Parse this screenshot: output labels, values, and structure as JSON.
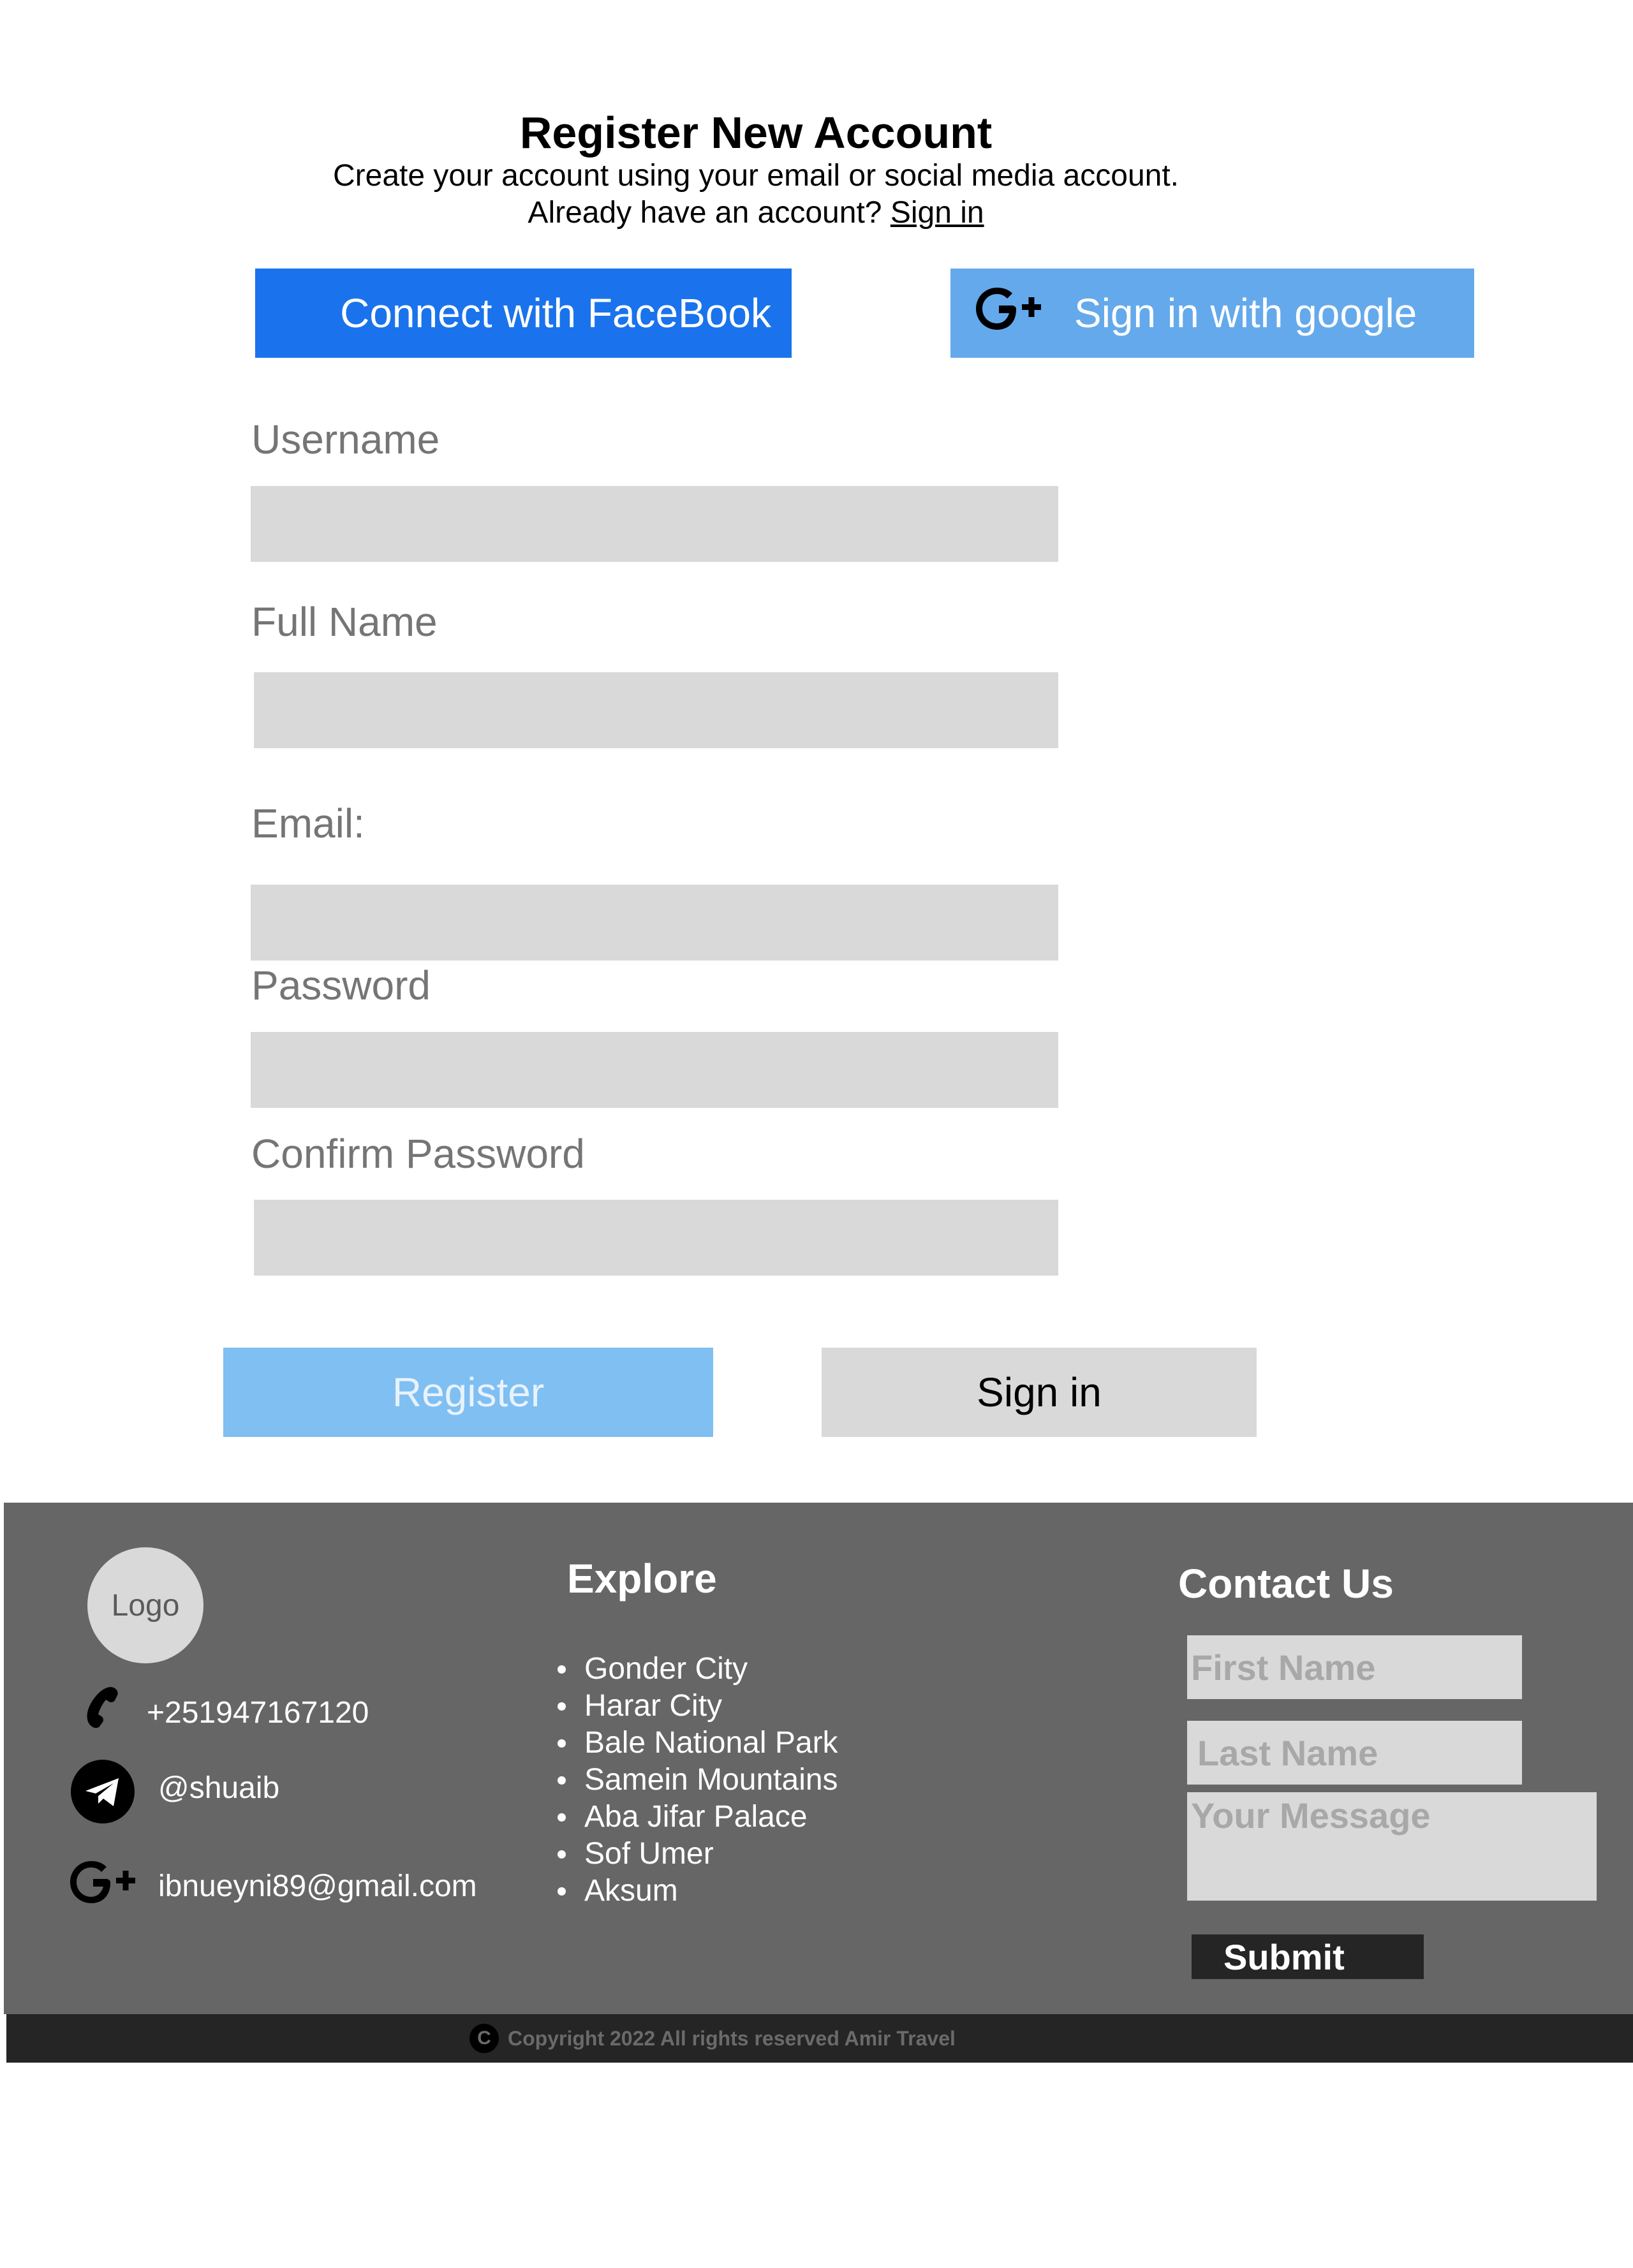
{
  "header": {
    "title": "Register New Account",
    "subtitle": "Create your account using your email or social media account.",
    "already_text": "Already have an account?",
    "signin_link": "Sign in"
  },
  "social": {
    "facebook_label": "Connect with FaceBook",
    "google_label": "Sign in with google",
    "google_icon": "google-plus-icon"
  },
  "form": {
    "username_label": "Username",
    "fullname_label": "Full Name",
    "email_label": "Email:",
    "password_label": "Password",
    "confirm_label": "Confirm Password",
    "username_value": "",
    "fullname_value": "",
    "email_value": "",
    "password_value": "",
    "confirm_value": ""
  },
  "actions": {
    "register_label": "Register",
    "signin_label": "Sign in"
  },
  "footer": {
    "logo_label": "Logo",
    "phone": "+251947167120",
    "telegram": "@shuaib",
    "email": "ibnueyni89@gmail.com",
    "explore_heading": "Explore",
    "explore_items": [
      "Gonder City",
      "Harar City",
      "Bale National Park",
      "Samein Mountains",
      "Aba Jifar Palace",
      "Sof Umer",
      "Aksum"
    ],
    "contact_heading": "Contact Us",
    "first_name_placeholder": "First Name",
    "last_name_placeholder": "Last Name",
    "message_placeholder": "Your Message",
    "submit_label": "Submit",
    "copyright_icon_letter": "C",
    "copyright": "Copyright 2022 All rights reserved Amir Travel"
  },
  "colors": {
    "facebook": "#1a73ec",
    "google": "#64a9ec",
    "register": "#7fbff2",
    "footer_bg": "#666666",
    "copyright_bg": "#252525"
  }
}
